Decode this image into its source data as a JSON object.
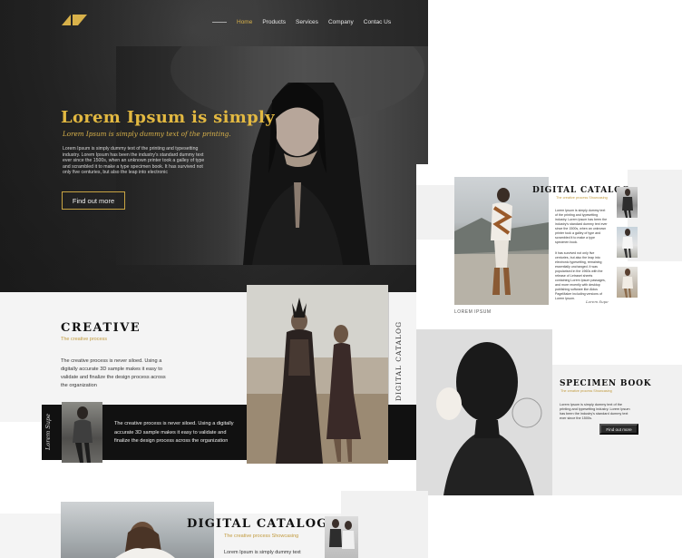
{
  "colors": {
    "gold": "#d8b14a",
    "dark": "#232323",
    "light_gray": "#f4f4f4"
  },
  "logo": {
    "icon": "brand-logo-icon"
  },
  "nav": {
    "items": [
      {
        "label": "Home",
        "active": true
      },
      {
        "label": "Products"
      },
      {
        "label": "Services"
      },
      {
        "label": "Company"
      },
      {
        "label": "Contac Us"
      }
    ]
  },
  "hero": {
    "title": "Lorem Ipsum is simply",
    "subtitle": "Lorem Ipsum is simply dummy text of the printing.",
    "body": "Lorem Ipsum is simply dummy text of the printing and typesetting industry. Lorem Ipsum has been the industry's standard dummy text ever since the 1500s, when an unknown printer took a galley of type and scrambled it to make a type specimen book. It has survived not only five centuries, but also the leap into electronic",
    "button": "Find out more"
  },
  "creative": {
    "title": "CREATIVE",
    "subtitle": "The creative process",
    "text": "The creative process is never siloed. Using a digitally accurate 3D sample makes it easy to validate and finalize the design process across the organization",
    "signature": "Lorem Supe",
    "band_text": "The creative process is never siloed. Using a digitally accurate 3D sample makes it easy to validate and finalize the design process across the organization",
    "vertical_label": "DIGITAL CATALOG"
  },
  "catalog": {
    "title": "DIGITAL CATALOG",
    "subtitle": "The creative process Showcasing",
    "text1": "Lorem Ipsum is simply dummy text of the printing and typesetting industry. Lorem Ipsum has been the industry's standard dummy text ever since the 1500s, when an unknown printer took a galley of type and scrambled it to make a type specimen book.",
    "text2": "It has survived not only five centuries, but also the leap into electronic typesetting, remaining essentially unchanged. It was popularised in the 1960s with the release of Letraset sheets containing Lorem Ipsum passages, and more recently with desktop publishing software like Aldus PageMaker including versions of Lorem Ipsum.",
    "signature": "Lorem Supe",
    "photo_label": "LOREM IPSUM"
  },
  "specimen": {
    "title": "SPECIMEN BOOK",
    "subtitle": "The creative process Showcasing",
    "text": "Lorem Ipsum is simply dummy text of the printing and typesetting industry. Lorem Ipsum has been the industry's standard dummy text ever since the 1500s.",
    "button": "Find out more"
  },
  "bottom_catalog": {
    "title": "DIGITAL CATALOG",
    "subtitle": "The creative process Showcasing",
    "text": "Lorem Ipsum is simply dummy text"
  }
}
